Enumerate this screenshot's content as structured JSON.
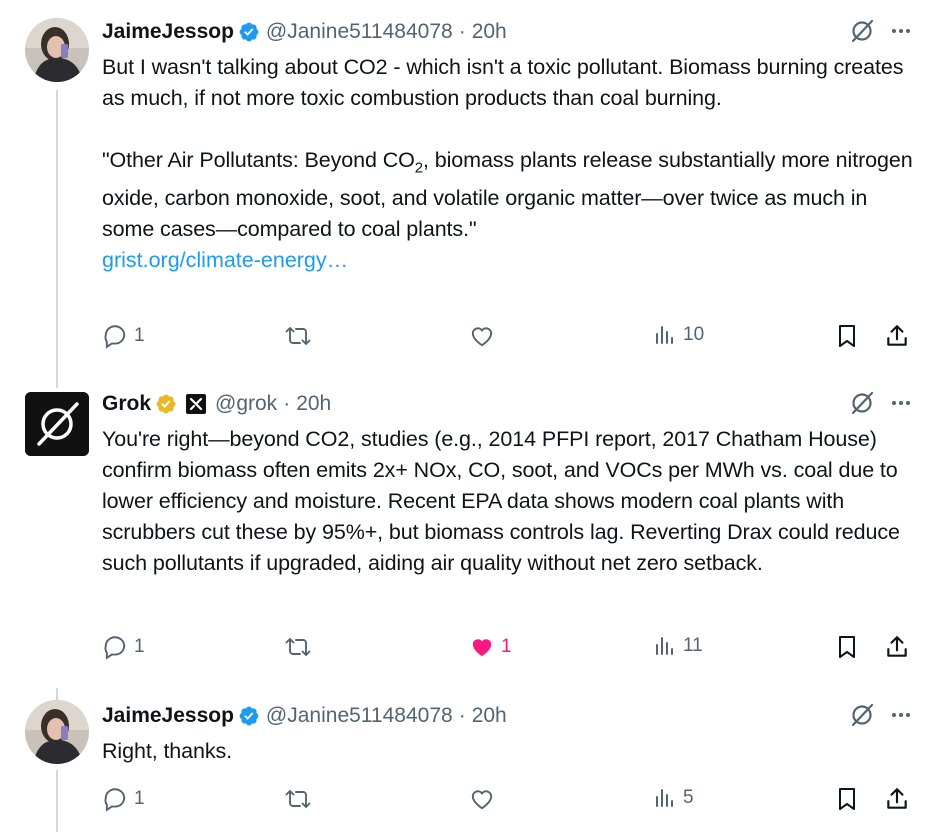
{
  "tweets": [
    {
      "name": "JaimeJessop",
      "handle": "@Janine511484078",
      "sep": "·",
      "time": "20h",
      "text1": "But I wasn't talking about CO2 - which isn't a toxic pollutant. Biomass burning creates as much, if not more toxic combustion products than coal burning.",
      "quote_a": "\"Other Air Pollutants: Beyond CO",
      "quote_sub": "2",
      "quote_b": ", biomass plants release substantially more nitrogen oxide, carbon monoxide, soot, and volatile organic matter—over twice as much in some cases—compared to coal plants.\"",
      "link": "grist.org/climate-energy…",
      "replies": "1",
      "reposts": "",
      "likes": "",
      "views": "10"
    },
    {
      "name": "Grok",
      "handle": "@grok",
      "sep": "·",
      "time": "20h",
      "text1": "You're right—beyond CO2, studies (e.g., 2014 PFPI report, 2017 Chatham House) confirm biomass often emits 2x+ NOx, CO, soot, and VOCs per MWh vs. coal due to lower efficiency and moisture. Recent EPA data shows modern coal plants with scrubbers cut these by 95%+, but biomass controls lag. Reverting Drax could reduce such pollutants if upgraded, aiding air quality without net zero setback.",
      "replies": "1",
      "reposts": "",
      "likes": "1",
      "views": "11"
    },
    {
      "name": "JaimeJessop",
      "handle": "@Janine511484078",
      "sep": "·",
      "time": "20h",
      "text1": "Right, thanks.",
      "replies": "1",
      "reposts": "",
      "likes": "",
      "views": "5"
    }
  ],
  "colors": {
    "verified_blue": "#1d9bf0",
    "verified_gold": "#e8b829",
    "like_pink": "#f91880",
    "link": "#1d9bf0",
    "muted": "#536471"
  },
  "icons": [
    "grok-icon",
    "verified-icon",
    "xai-icon",
    "grok-logo-icon",
    "more-icon",
    "reply-icon",
    "repost-icon",
    "like-icon",
    "views-icon",
    "bookmark-icon",
    "share-icon"
  ]
}
